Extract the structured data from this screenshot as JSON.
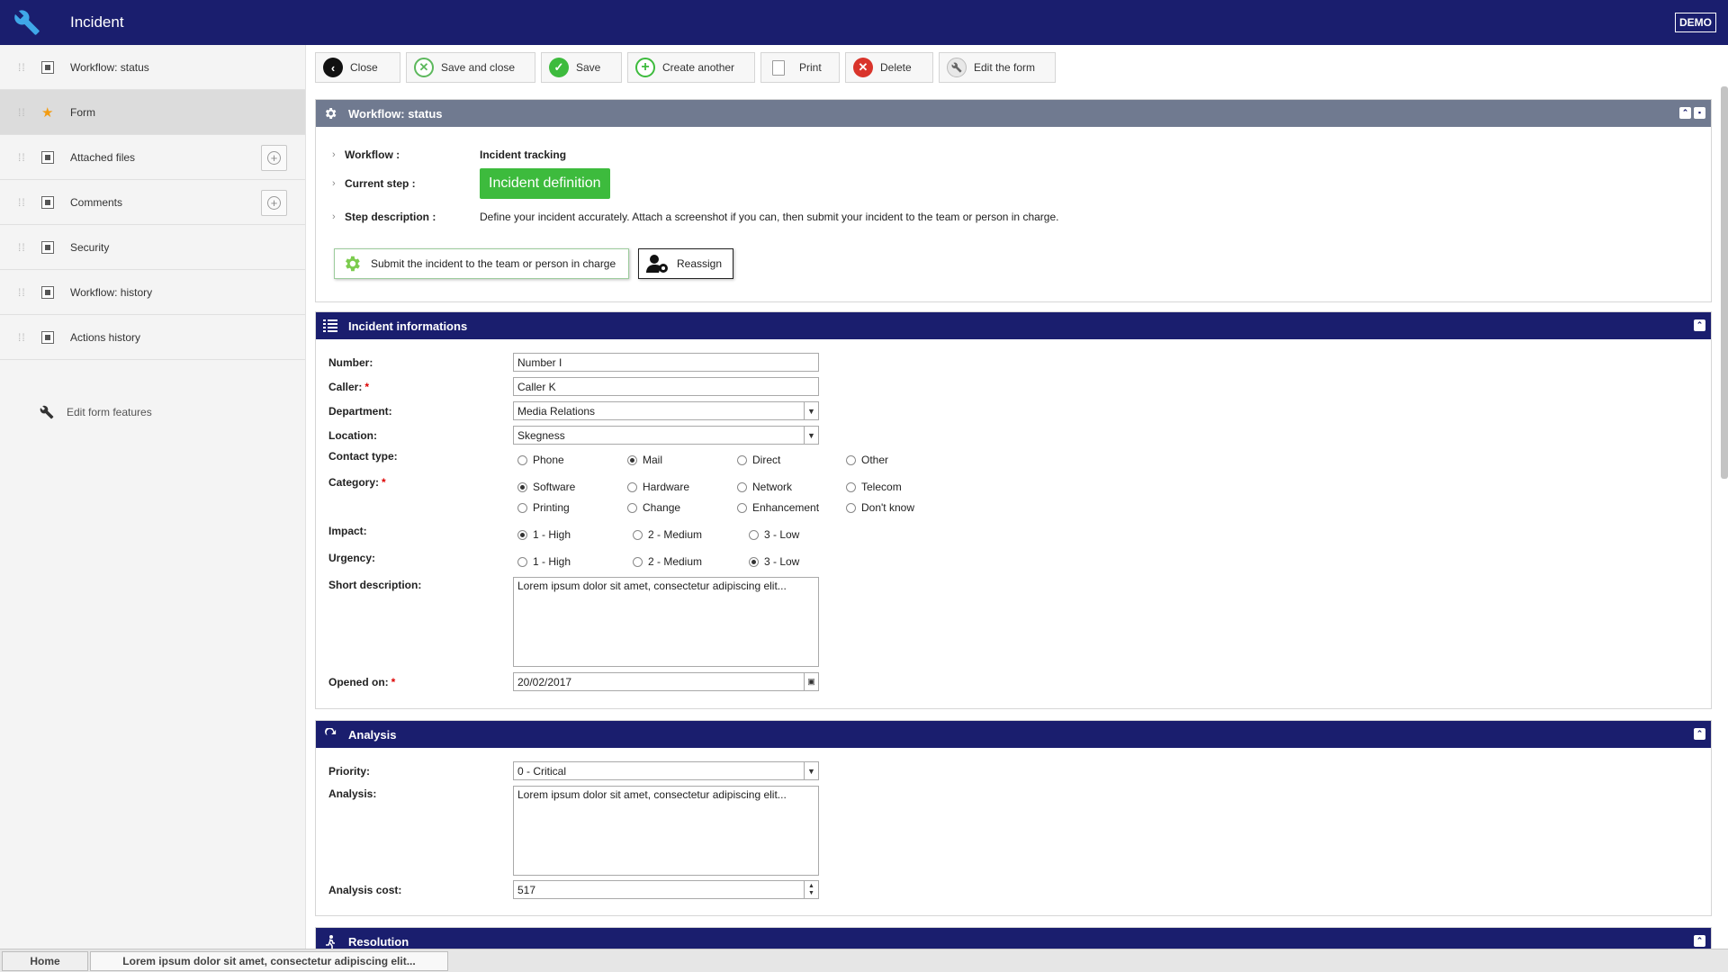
{
  "app": {
    "title": "Incident",
    "env_badge": "DEMO"
  },
  "sidebar": {
    "items": [
      {
        "label": "Workflow: status",
        "icon": "pin-icon",
        "add": false
      },
      {
        "label": "Form",
        "icon": "star-icon",
        "add": false,
        "active": true
      },
      {
        "label": "Attached files",
        "icon": "pin-icon",
        "add": true
      },
      {
        "label": "Comments",
        "icon": "pin-icon",
        "add": true
      },
      {
        "label": "Security",
        "icon": "pin-icon",
        "add": false
      },
      {
        "label": "Workflow: history",
        "icon": "pin-icon",
        "add": false
      },
      {
        "label": "Actions history",
        "icon": "pin-icon",
        "add": false
      }
    ],
    "edit_features": "Edit form features"
  },
  "toolbar": {
    "close": "Close",
    "save_close": "Save and close",
    "save": "Save",
    "create_another": "Create another",
    "print": "Print",
    "delete": "Delete",
    "edit_form": "Edit the form"
  },
  "workflow_panel": {
    "title": "Workflow: status",
    "workflow_label": "Workflow :",
    "workflow_value": "Incident tracking",
    "step_label": "Current step :",
    "step_value": "Incident definition",
    "desc_label": "Step description :",
    "desc_value": "Define your incident accurately. Attach a screenshot if you can, then submit your incident to the team or person in charge.",
    "submit_button": "Submit the incident to the team or person in charge",
    "reassign_button": "Reassign"
  },
  "incident_panel": {
    "title": "Incident informations",
    "number_label": "Number:",
    "number_value": "Number I",
    "caller_label": "Caller:",
    "caller_value": "Caller K",
    "department_label": "Department:",
    "department_value": "Media Relations",
    "location_label": "Location:",
    "location_value": "Skegness",
    "contact_label": "Contact type:",
    "contact_options": [
      "Phone",
      "Mail",
      "Direct",
      "Other"
    ],
    "contact_selected": "Mail",
    "category_label": "Category:",
    "category_options": [
      "Software",
      "Hardware",
      "Network",
      "Telecom",
      "Printing",
      "Change",
      "Enhancement",
      "Don't know"
    ],
    "category_selected": "Software",
    "impact_label": "Impact:",
    "impact_options": [
      "1 - High",
      "2 - Medium",
      "3 - Low"
    ],
    "impact_selected": "1 - High",
    "urgency_label": "Urgency:",
    "urgency_options": [
      "1 - High",
      "2 - Medium",
      "3 - Low"
    ],
    "urgency_selected": "3 - Low",
    "short_desc_label": "Short description:",
    "short_desc_value": "Lorem ipsum dolor sit amet, consectetur adipiscing elit...",
    "opened_label": "Opened on:",
    "opened_value": "20/02/2017"
  },
  "analysis_panel": {
    "title": "Analysis",
    "priority_label": "Priority:",
    "priority_value": "0 - Critical",
    "analysis_label": "Analysis:",
    "analysis_value": "Lorem ipsum dolor sit amet, consectetur adipiscing elit...",
    "cost_label": "Analysis cost:",
    "cost_value": "517"
  },
  "resolution_panel": {
    "title": "Resolution"
  },
  "statusbar": {
    "home": "Home",
    "current": "Lorem ipsum dolor sit amet, consectetur adipiscing elit..."
  },
  "colors": {
    "header": "#1a1e6e",
    "step_badge": "#3dbb3d",
    "delete": "#d9342b",
    "save": "#3dbb3d"
  }
}
